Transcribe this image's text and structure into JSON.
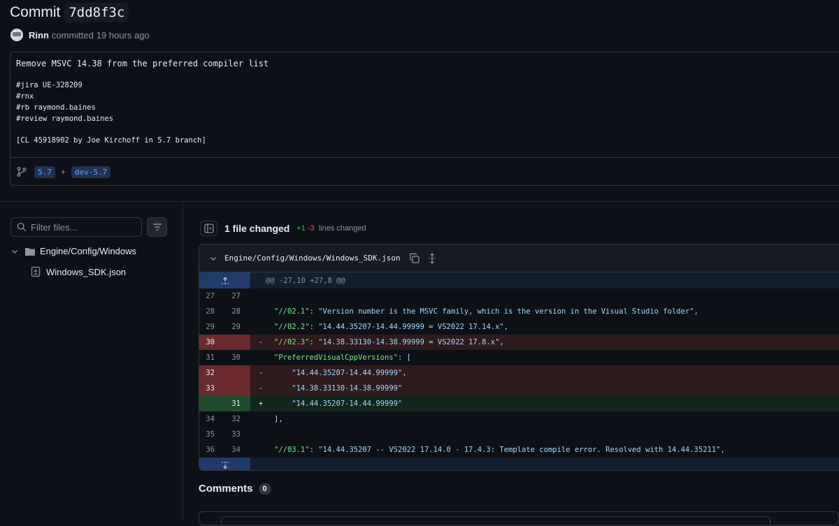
{
  "header": {
    "title_word": "Commit",
    "sha": "7dd8f3c",
    "author": "Rinn",
    "verb": "committed",
    "time": "19 hours ago"
  },
  "message": {
    "title": "Remove MSVC 14.38 from the preferred compiler list",
    "lines": [
      "#jira UE-328209",
      "#rnx",
      "#rb raymond.baines",
      "#review raymond.baines"
    ],
    "footer_line": "[CL 45918902 by Joe Kirchoff in 5.7 branch]",
    "branches": [
      "5.7",
      "dev-5.7"
    ],
    "branch_sep": "+"
  },
  "sidebar": {
    "filter_placeholder": "Filter files...",
    "folder": "Engine/Config/Windows",
    "file": "Windows_SDK.json"
  },
  "diff": {
    "files_changed": "1 file changed",
    "additions": "+1",
    "deletions": "-3",
    "lines_changed": "lines changed",
    "file_path": "Engine/Config/Windows/Windows_SDK.json",
    "hunk_header": "@@ -27,10 +27,8 @@",
    "rows": [
      {
        "type": "ctx",
        "old": "27",
        "new": "27",
        "sign": "",
        "key": "",
        "rest": ""
      },
      {
        "type": "ctx",
        "old": "28",
        "new": "28",
        "sign": "",
        "key": "\"//02.1\"",
        "rest": ": \"Version number is the MSVC family, which is the version in the Visual Studio folder\","
      },
      {
        "type": "ctx",
        "old": "29",
        "new": "29",
        "sign": "",
        "key": "\"//02.2\"",
        "rest": ": \"14.44.35207-14.44.99999 = VS2022 17.14.x\","
      },
      {
        "type": "del",
        "old": "30",
        "new": "",
        "sign": "-",
        "key": "\"//02.3\"",
        "rest": ": \"14.38.33130-14.38.99999 = VS2022 17.8.x\","
      },
      {
        "type": "ctx",
        "old": "31",
        "new": "30",
        "sign": "",
        "key": "\"PreferredVisualCppVersions\"",
        "rest": ": ["
      },
      {
        "type": "del",
        "old": "32",
        "new": "",
        "sign": "-",
        "key": "",
        "rest": "    \"14.44.35207-14.44.99999\","
      },
      {
        "type": "del",
        "old": "33",
        "new": "",
        "sign": "-",
        "key": "",
        "rest": "    \"14.38.33130-14.38.99999\""
      },
      {
        "type": "add",
        "old": "",
        "new": "31",
        "sign": "+",
        "key": "",
        "rest": "    \"14.44.35207-14.44.99999\""
      },
      {
        "type": "ctx",
        "old": "34",
        "new": "32",
        "sign": "",
        "key": "",
        "rest": "],"
      },
      {
        "type": "ctx",
        "old": "35",
        "new": "33",
        "sign": "",
        "key": "",
        "rest": ""
      },
      {
        "type": "ctx",
        "old": "36",
        "new": "34",
        "sign": "",
        "key": "\"//03.1\"",
        "rest": ": \"14.44.35207 -- VS2022 17.14.0 - 17.4.3: Template compile error. Resolved with 14.44.35211\","
      }
    ]
  },
  "comments": {
    "label": "Comments",
    "count": "0"
  }
}
